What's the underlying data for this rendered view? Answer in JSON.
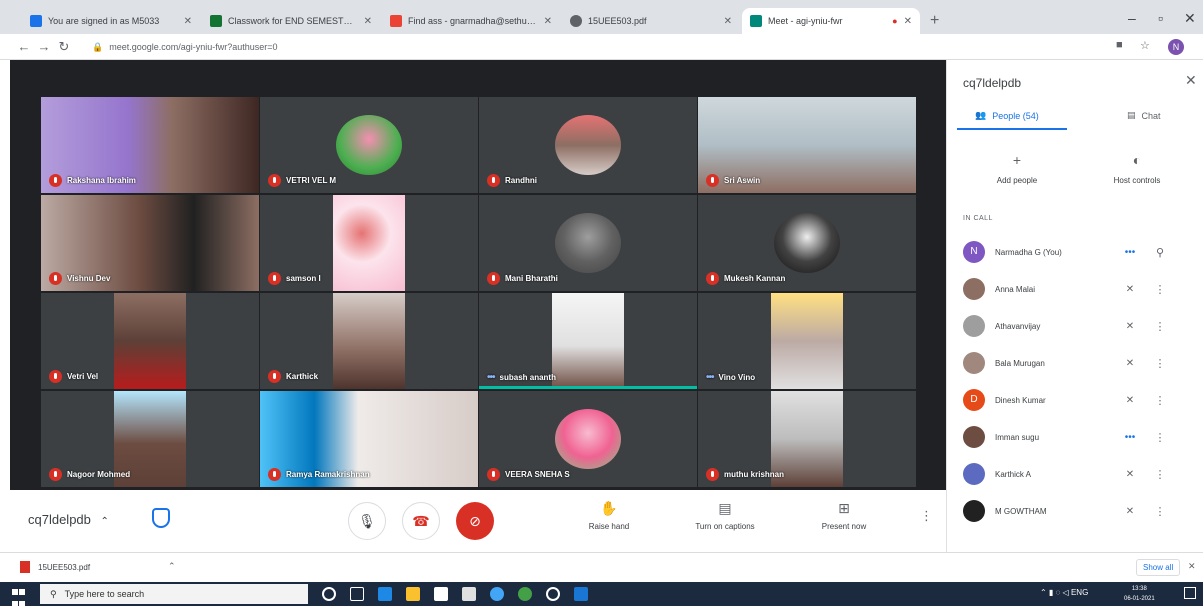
{
  "browser": {
    "tabs": [
      {
        "title": "You are signed in as M5033",
        "favicon": "blue-square-icon"
      },
      {
        "title": "Classwork for END SEMESTER (",
        "favicon": "classroom-icon"
      },
      {
        "title": "Find ass - gnarmadha@sethu.ac",
        "favicon": "gmail-icon"
      },
      {
        "title": "15UEE503.pdf",
        "favicon": "globe-icon"
      },
      {
        "title": "Meet - agi-yniu-fwr",
        "favicon": "meet-icon",
        "active": true
      }
    ],
    "url": "meet.google.com/agi-yniu-fwr?authuser=0",
    "profile_initial": "N"
  },
  "meet": {
    "meeting_code": "cq7ldelpdb",
    "tiles": [
      {
        "name": "Rakshana Ibrahim"
      },
      {
        "name": "VETRI VEL M"
      },
      {
        "name": "Randhni"
      },
      {
        "name": "Sri Aswin"
      },
      {
        "name": "Vishnu Dev"
      },
      {
        "name": "samson I"
      },
      {
        "name": "Mani Bharathi"
      },
      {
        "name": "Mukesh Kannan"
      },
      {
        "name": "Vetri Vel"
      },
      {
        "name": "Karthick"
      },
      {
        "name": "subash ananth"
      },
      {
        "name": "Vino Vino"
      },
      {
        "name": "Nagoor Mohmed"
      },
      {
        "name": "Ramya Ramakrishnan"
      },
      {
        "name": "VEERA SNEHA S"
      },
      {
        "name": "muthu krishnan"
      }
    ],
    "controls": {
      "raise_hand": "Raise hand",
      "captions": "Turn on captions",
      "present": "Present now"
    }
  },
  "panel": {
    "code": "cq7ldelpdb",
    "people_tab": "People (54)",
    "chat_tab": "Chat",
    "add_people": "Add people",
    "host_controls": "Host controls",
    "in_call": "IN CALL",
    "participants": [
      {
        "name": "Narmadha G (You)",
        "initial": "N",
        "color": "#7e57c2",
        "status": "..."
      },
      {
        "name": "Anna Malai",
        "initial": "",
        "color": "#8d6e63",
        "status": "muted"
      },
      {
        "name": "Athavanvijay",
        "initial": "",
        "color": "#9e9e9e",
        "status": "muted"
      },
      {
        "name": "Bala Murugan",
        "initial": "",
        "color": "#a1887f",
        "status": "muted"
      },
      {
        "name": "Dinesh Kumar",
        "initial": "D",
        "color": "#e64a19",
        "status": "muted"
      },
      {
        "name": "Imman sugu",
        "initial": "",
        "color": "#6d4c41",
        "status": "..."
      },
      {
        "name": "Karthick A",
        "initial": "",
        "color": "#5c6bc0",
        "status": "muted"
      },
      {
        "name": "M GOWTHAM",
        "initial": "",
        "color": "#212121",
        "status": "muted"
      }
    ]
  },
  "downloads": {
    "file": "15UEE503.pdf",
    "show_all": "Show all"
  },
  "taskbar": {
    "search_placeholder": "Type here to search",
    "language": "ENG",
    "time": "13:38",
    "date": "06-01-2021"
  }
}
